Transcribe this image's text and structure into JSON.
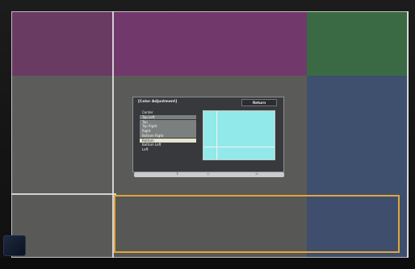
{
  "menu": {
    "title": "[Color Adjustment]",
    "return_label": "Return",
    "items": [
      {
        "label": "Center"
      },
      {
        "label": "Top Left"
      },
      {
        "label": "Top"
      },
      {
        "label": "Top Right"
      },
      {
        "label": "Right"
      },
      {
        "label": "Bottom Right"
      },
      {
        "label": "Bottom"
      },
      {
        "label": "Bottom Left"
      },
      {
        "label": "Left"
      }
    ],
    "selected_item": "Bottom"
  },
  "nav_bar": {
    "symbols": [
      "↕",
      "◇",
      "☰"
    ]
  },
  "colors": {
    "selection_border": "#e0a63a",
    "preview_fill": "#92e9ea",
    "menu_background": "#34363a"
  },
  "icons": {
    "device": "remote-device-icon"
  }
}
